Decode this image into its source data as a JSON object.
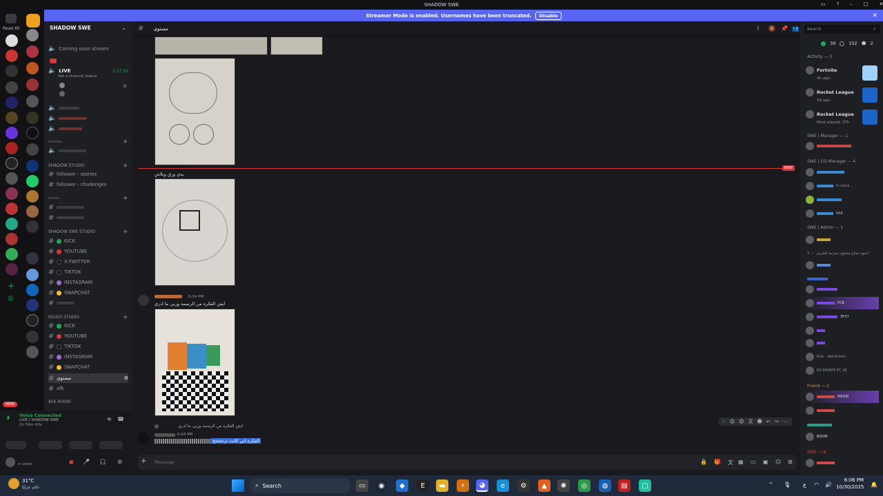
{
  "window": {
    "title": "SHADOW SWE"
  },
  "banner": {
    "text": "Streamer Mode is enabled. Usernames have been truncated.",
    "button": "Disable"
  },
  "guilds": {
    "read_all": "Read All"
  },
  "server": {
    "name": "SHADOW SWE"
  },
  "channels": {
    "top_item": "Coming soon stream",
    "live_label": "LIVE",
    "live_time": "2:57:52",
    "live_status": "Set a channel status",
    "cat_shadow_studio": "Shadow studio",
    "follower_stories": "follower - stories",
    "follower_challenges": "follower - challenges",
    "cat_studio1": "SHADOW SWE STUDIO",
    "kick": "KICK",
    "youtube": "YOUTUBE",
    "xtwitter": "X-TWITTER",
    "tiktok": "TIKTOK",
    "instagram": "INSTAGRAM",
    "snapchat": "SNAPCHAT",
    "cat_koleo": "KOLEO STUDIO",
    "kick2": "KICK",
    "youtube2": "YOUTUBE",
    "tiktok2": "TIKTOK",
    "instagram2": "INSTAGRAM",
    "snapchat2": "SNAPCHAT",
    "selected": "مستوى",
    "afk": "afk",
    "afk_room": "AFK ROOM"
  },
  "voice": {
    "status": "Voice Connected",
    "sub": "LIVE / SHADOW SWE",
    "time": "2h 56m 43s",
    "user": "in voice"
  },
  "header": {
    "channel": "مستوى"
  },
  "chat": {
    "new_badge": "NEW",
    "msg1_text": "بدي ورق وبلاش",
    "msg2_time": "6:04 PM",
    "msg2_text": "ابش الفكره من الرسمه وربي ما ادري",
    "reply_text": "ابش الفكره من الرسمه وربي ما ادري",
    "msg3_time": "6:04 PM",
    "msg3_text": "الفكره اني كانت ترخخخخ",
    "composer_placeholder": "Message"
  },
  "members": {
    "search_placeholder": "Search",
    "online_count": "39",
    "offline_count": "102",
    "other_count": "2",
    "activity": "Activity — 3",
    "act1_game": "Fortnite",
    "act1_time": "4h ago",
    "act2_game": "Rocket League",
    "act2_time": "3d ago",
    "act3_game": "Rocket League",
    "act3_time": "Most played: 27h",
    "cat_manager": "SWE | Manager — 1",
    "cat_co": "SWE | CO Manager — 4",
    "cat_admin": "SWE | Admin — 1",
    "cat_creator": "1 — اسوه صناع محتوى بحرتبة الشرف",
    "cat_friend": "Friend — 2",
    "cat_swe": "SWE — 8",
    "m_invoice": "In voice",
    "m_kick": "Kick - Abo3mmrr",
    "m_sports": "EA SPORTS FC 26",
    "m_fcb": "FCB",
    "m_meow": "MEOW",
    "m_boom": "BOOM",
    "m_3fx": "3FX7",
    "m_6a6": "6A6"
  },
  "taskbar": {
    "weather_temp": "31°C",
    "weather_desc": "غائم جزئيًا",
    "search": "Search",
    "time": "6:06 PM",
    "date": "10/30/2025",
    "lang": "ع"
  }
}
